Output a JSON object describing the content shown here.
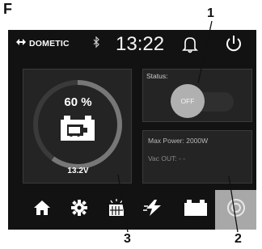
{
  "figure": {
    "letter": "F"
  },
  "callouts": {
    "c1": "1",
    "c2": "2",
    "c3": "3"
  },
  "header": {
    "brand": "DOMETIC",
    "time": "13:22",
    "icons": [
      "bluetooth-icon",
      "bell-icon",
      "power-icon"
    ]
  },
  "battery": {
    "percent": "60 %",
    "charge_fraction": 0.6,
    "voltage": "13.2V"
  },
  "status": {
    "label": "Status:",
    "toggle_label": "OFF"
  },
  "power": {
    "max_power": "Max Power: 2000W",
    "vac_out": "Vac OUT: - -"
  },
  "nav": {
    "items": [
      "home-icon",
      "gear-icon",
      "battery-charger-icon",
      "lightning-icon",
      "battery-icon",
      "settings-dial-icon"
    ],
    "active_index": 5
  },
  "colors": {
    "screen": "#121212",
    "panel": "#242424",
    "gauge_arc": "#777777",
    "gauge_track": "#3a3a3a"
  }
}
